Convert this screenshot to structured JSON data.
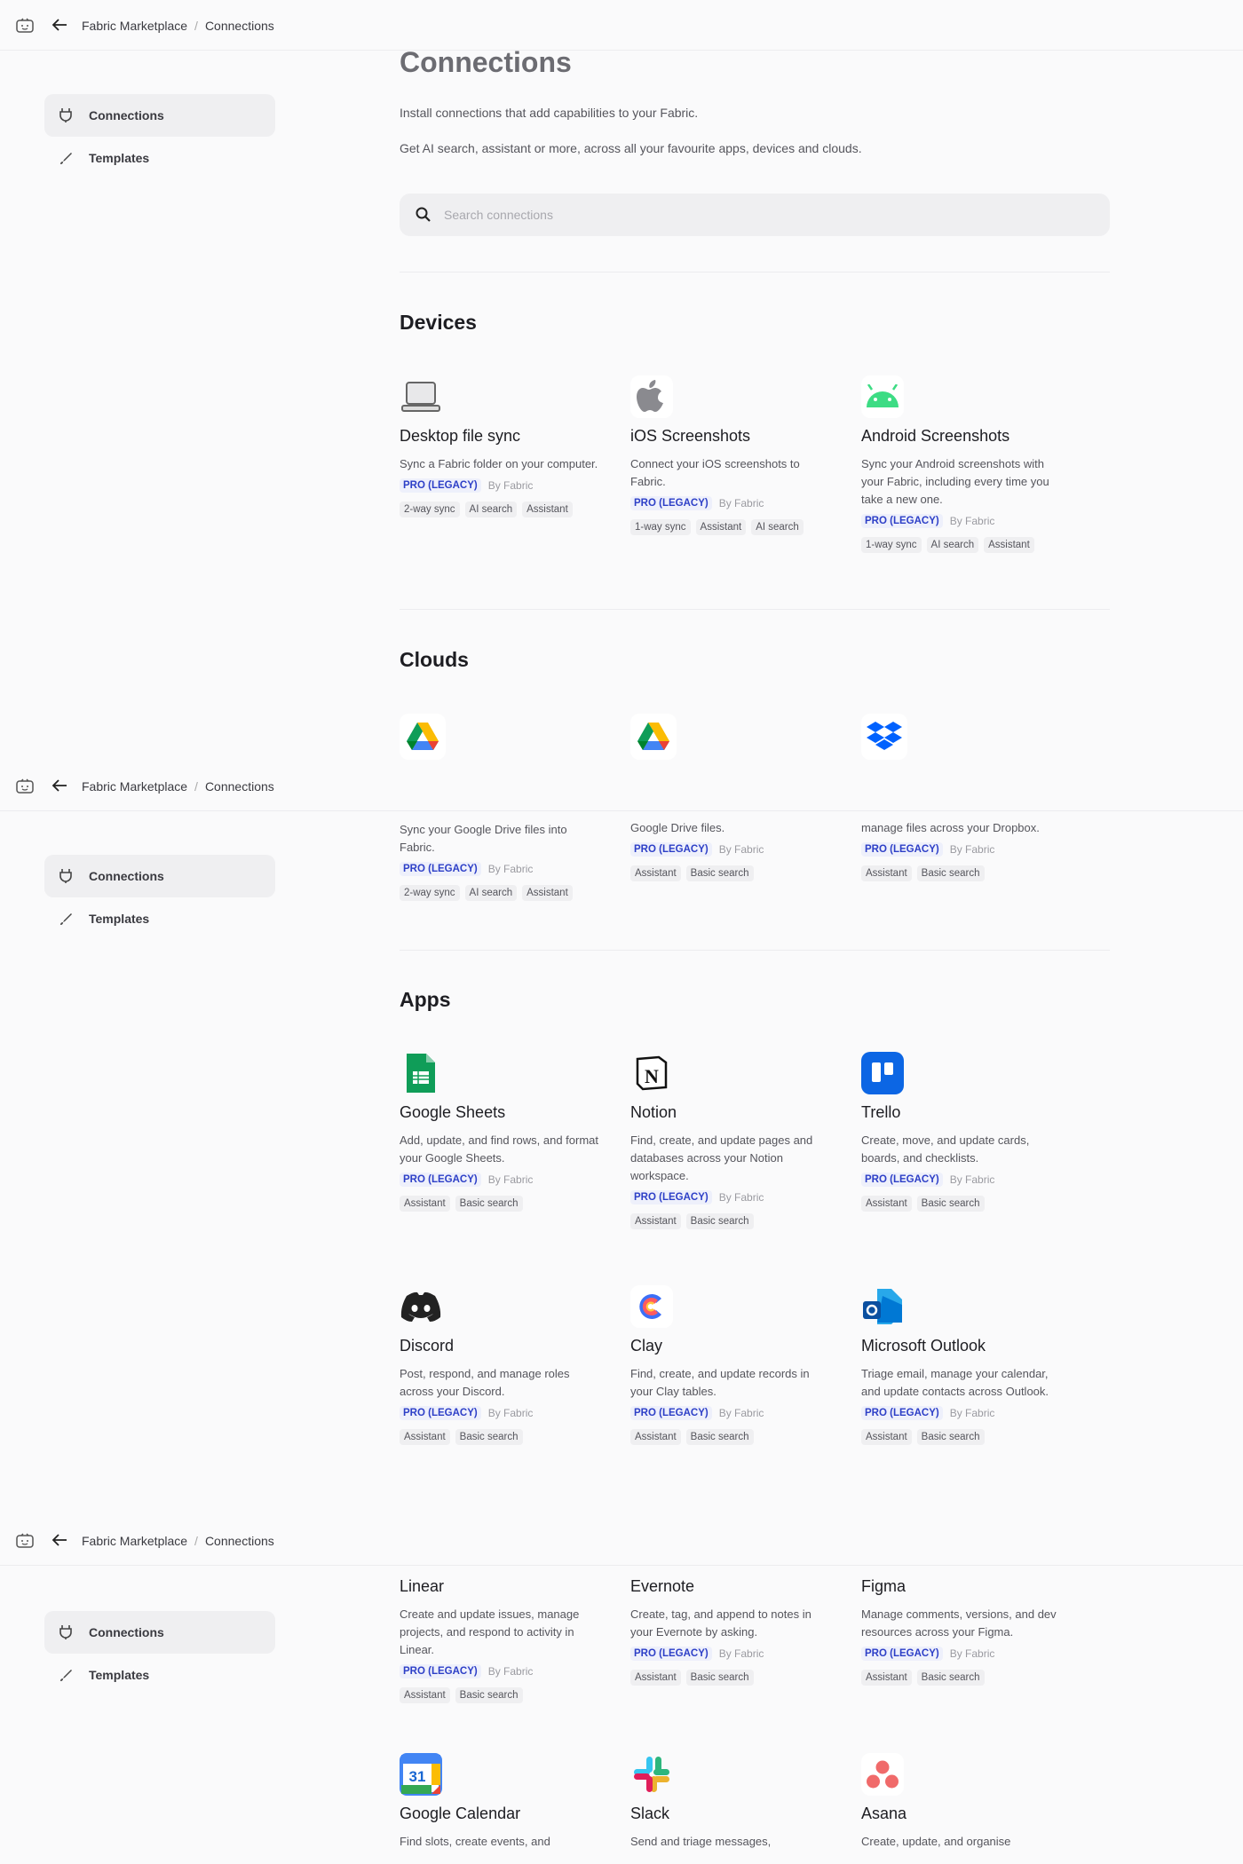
{
  "breadcrumb": {
    "root": "Fabric Marketplace",
    "separator": "/",
    "current": "Connections"
  },
  "sidebar": {
    "items": [
      {
        "label": "Connections",
        "icon": "plug-icon"
      },
      {
        "label": "Templates",
        "icon": "brush-icon"
      }
    ]
  },
  "page": {
    "title": "Connections",
    "intro1": "Install connections that add capabilities to your Fabric.",
    "intro2": "Get AI search, assistant or more, across all your favourite apps, devices and clouds.",
    "search_placeholder": "Search connections"
  },
  "sections": {
    "devices": "Devices",
    "clouds": "Clouds",
    "apps": "Apps"
  },
  "pro_label": "PRO (LEGACY)",
  "by_label": "By Fabric",
  "devices": [
    {
      "name": "Desktop file sync",
      "desc": "Sync a Fabric folder on your computer.",
      "tags": [
        "2-way sync",
        "AI search",
        "Assistant"
      ]
    },
    {
      "name": "iOS Screenshots",
      "desc": "Connect your iOS screenshots to Fabric.",
      "tags": [
        "1-way sync",
        "Assistant",
        "AI search"
      ]
    },
    {
      "name": "Android Screenshots",
      "desc": "Sync your Android screenshots with your Fabric, including every time you take a new one.",
      "tags": [
        "1-way sync",
        "AI search",
        "Assistant"
      ]
    }
  ],
  "clouds": [
    {
      "desc": "Sync your Google Drive files into Fabric.",
      "tags": [
        "2-way sync",
        "AI search",
        "Assistant"
      ]
    },
    {
      "desc": "Google Drive files.",
      "tags": [
        "Assistant",
        "Basic search"
      ]
    },
    {
      "desc": "manage files across your Dropbox.",
      "tags": [
        "Assistant",
        "Basic search"
      ]
    }
  ],
  "apps_row1": [
    {
      "name": "Google Sheets",
      "desc": "Add, update, and find rows, and format your Google Sheets.",
      "tags": [
        "Assistant",
        "Basic search"
      ]
    },
    {
      "name": "Notion",
      "desc": "Find, create, and update pages and databases across your Notion workspace.",
      "tags": [
        "Assistant",
        "Basic search"
      ]
    },
    {
      "name": "Trello",
      "desc": "Create, move, and update cards, boards, and checklists.",
      "tags": [
        "Assistant",
        "Basic search"
      ]
    }
  ],
  "apps_row2": [
    {
      "name": "Discord",
      "desc": "Post, respond, and manage roles across your Discord.",
      "tags": [
        "Assistant",
        "Basic search"
      ]
    },
    {
      "name": "Clay",
      "desc": "Find, create, and update records in your Clay tables.",
      "tags": [
        "Assistant",
        "Basic search"
      ]
    },
    {
      "name": "Microsoft Outlook",
      "desc": "Triage email, manage your calendar, and update contacts across Outlook.",
      "tags": [
        "Assistant",
        "Basic search"
      ]
    }
  ],
  "apps_row3": [
    {
      "name": "Linear",
      "desc": "Create and update issues, manage projects, and respond to activity in Linear.",
      "tags": [
        "Assistant",
        "Basic search"
      ]
    },
    {
      "name": "Evernote",
      "desc": "Create, tag, and append to notes in your Evernote by asking.",
      "tags": [
        "Assistant",
        "Basic search"
      ]
    },
    {
      "name": "Figma",
      "desc": "Manage comments, versions, and dev resources across your Figma.",
      "tags": [
        "Assistant",
        "Basic search"
      ]
    }
  ],
  "apps_row4": [
    {
      "name": "Google Calendar",
      "desc": "Find slots, create events, and"
    },
    {
      "name": "Slack",
      "desc": "Send and triage messages,"
    },
    {
      "name": "Asana",
      "desc": "Create, update, and organise"
    }
  ],
  "colors": {
    "accent": "#2d3fc7",
    "background": "#fafafb"
  }
}
